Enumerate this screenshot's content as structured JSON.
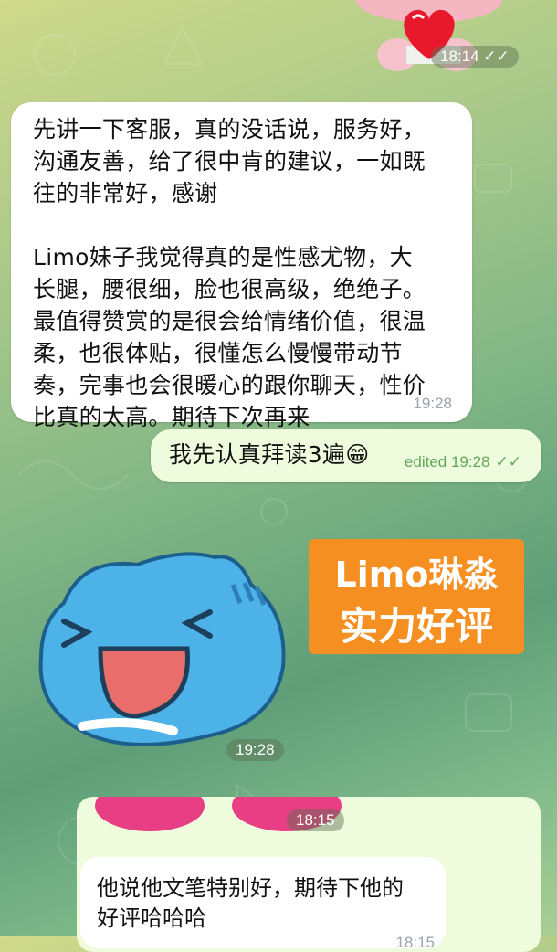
{
  "messages": {
    "top_sticker_time": "18:14",
    "incoming_text": "先讲一下客服，真的没话说，服务好，\n沟通友善，给了很中肯的建议，一如既\n往的非常好，感谢\n\nLimo妹子我觉得真的是性感尤物，大\n长腿，腰很细，脸也很高级，绝绝子。\n最值得赞赏的是很会给情绪价值，很温\n柔，也很体贴，很懂怎么慢慢带动节\n奏，完事也会很暖心的跟你聊天，性价\n比真的太高。期待下次再来",
    "incoming_time": "19:28",
    "outgoing_text": "我先认真拜读3遍😁",
    "outgoing_edited": "edited 19:28",
    "badge_line1": "Limo琳淼",
    "badge_line2": "实力好评",
    "cat_sticker_time": "19:28",
    "forward_sticker_time": "18:15",
    "forward_text": "他说他文笔特别好，期待下他的\n好评哈哈哈",
    "forward_time": "18:15"
  },
  "colors": {
    "incoming_bubble": "#ffffff",
    "outgoing_bubble": "#eefbdc",
    "badge": "#f58f21",
    "check": "#5fa85a"
  },
  "icons": [
    "double-check-icon",
    "heart-icon"
  ]
}
